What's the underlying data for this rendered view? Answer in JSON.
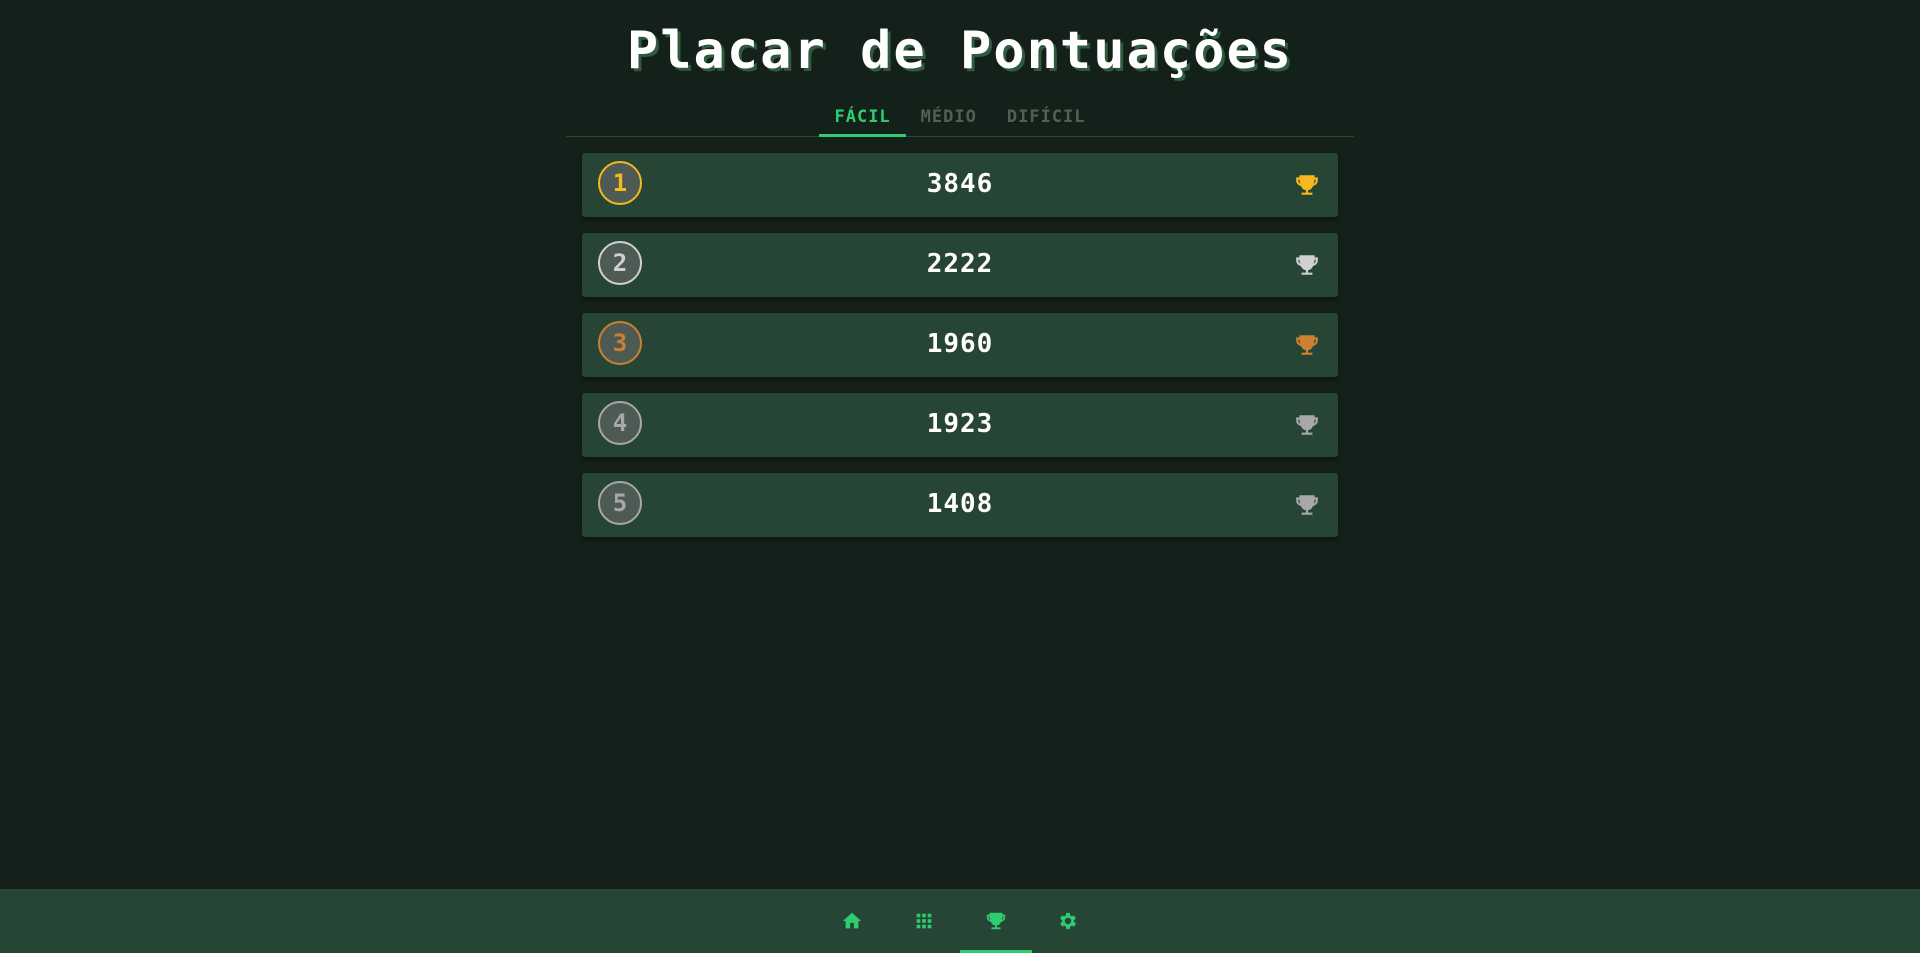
{
  "page": {
    "title": "Placar de Pontuações"
  },
  "tabs": [
    {
      "label": "FÁCIL",
      "active": true
    },
    {
      "label": "MÉDIO",
      "active": false
    },
    {
      "label": "DIFÍCIL",
      "active": false
    }
  ],
  "scores": [
    {
      "rank": "1",
      "score": "3846",
      "color": "#f5b81f",
      "icon": "trophy-icon"
    },
    {
      "rank": "2",
      "score": "2222",
      "color": "#d0d0d0",
      "icon": "trophy-icon"
    },
    {
      "rank": "3",
      "score": "1960",
      "color": "#cd7f32",
      "icon": "trophy-icon"
    },
    {
      "rank": "4",
      "score": "1923",
      "color": "#a8a8a8",
      "icon": "trophy-icon"
    },
    {
      "rank": "5",
      "score": "1408",
      "color": "#a8a8a8",
      "icon": "trophy-icon"
    }
  ],
  "nav": [
    {
      "icon": "home-icon",
      "active": false
    },
    {
      "icon": "grid-icon",
      "active": false
    },
    {
      "icon": "trophy-icon",
      "active": true
    },
    {
      "icon": "gear-icon",
      "active": false
    }
  ],
  "colors": {
    "accent": "#2ecc71",
    "background": "#13211a",
    "card": "#264535"
  }
}
